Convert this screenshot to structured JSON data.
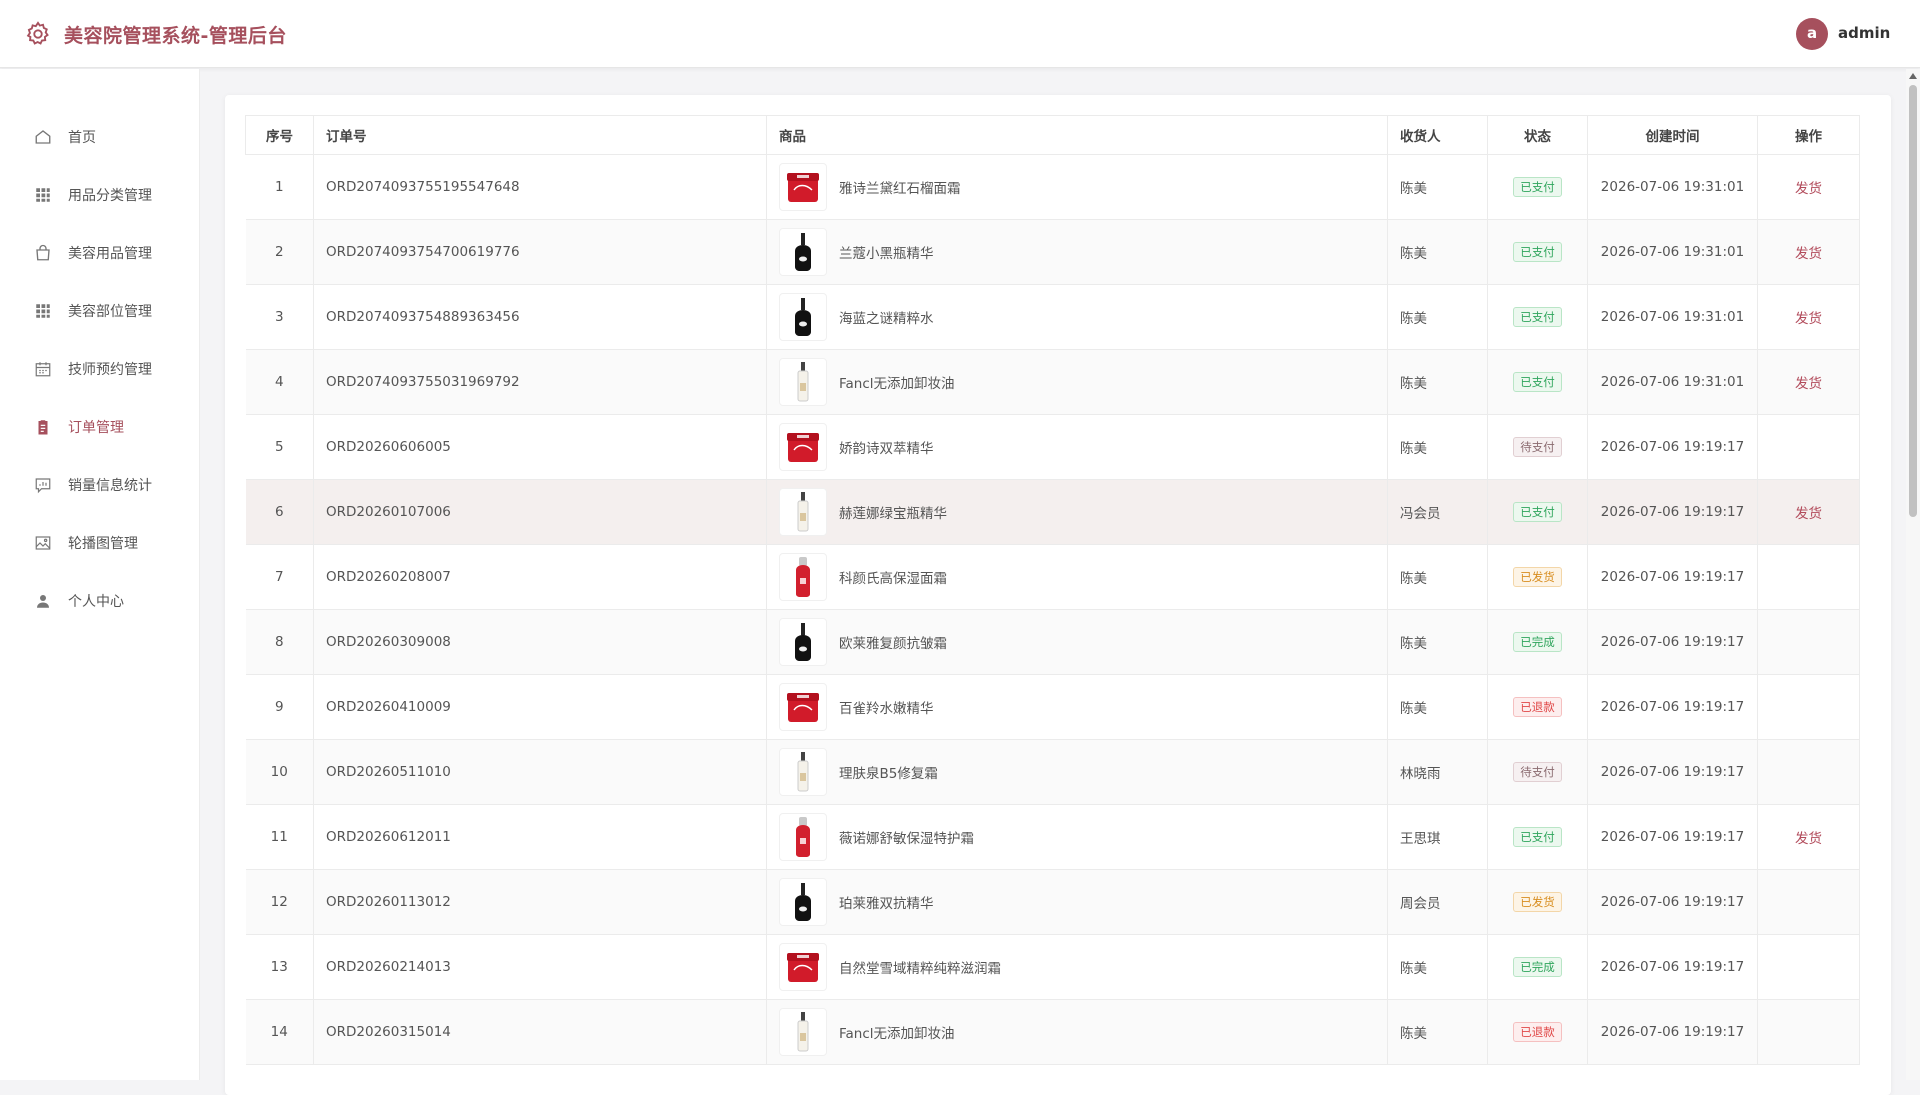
{
  "header": {
    "title": "美容院管理系统-管理后台",
    "avatar_letter": "a",
    "username": "admin",
    "brand_color": "#a6505d"
  },
  "sidebar": {
    "items": [
      {
        "label": "首页",
        "icon": "home-icon"
      },
      {
        "label": "用品分类管理",
        "icon": "grid-icon"
      },
      {
        "label": "美容用品管理",
        "icon": "bag-icon"
      },
      {
        "label": "美容部位管理",
        "icon": "grid-icon"
      },
      {
        "label": "技师预约管理",
        "icon": "calendar-icon"
      },
      {
        "label": "订单管理",
        "icon": "clipboard-icon",
        "active": true
      },
      {
        "label": "销量信息统计",
        "icon": "chat-chart-icon"
      },
      {
        "label": "轮播图管理",
        "icon": "image-icon"
      },
      {
        "label": "个人中心",
        "icon": "user-icon"
      }
    ]
  },
  "table": {
    "columns": [
      "序号",
      "订单号",
      "商品",
      "收货人",
      "状态",
      "创建时间",
      "操作"
    ],
    "rows": [
      {
        "no": "1",
        "order": "ORD2074093755195547648",
        "product": "雅诗兰黛红石榴面霜",
        "thumb": "jar",
        "receiver": "陈美",
        "status": "已支付",
        "status_type": "paid",
        "time": "2026-07-06 19:31:01",
        "action": "发货"
      },
      {
        "no": "2",
        "order": "ORD2074093754700619776",
        "product": "兰蔻小黑瓶精华",
        "thumb": "dropper",
        "receiver": "陈美",
        "status": "已支付",
        "status_type": "paid",
        "time": "2026-07-06 19:31:01",
        "action": "发货"
      },
      {
        "no": "3",
        "order": "ORD2074093754889363456",
        "product": "海蓝之谜精粹水",
        "thumb": "dropper",
        "receiver": "陈美",
        "status": "已支付",
        "status_type": "paid",
        "time": "2026-07-06 19:31:01",
        "action": "发货"
      },
      {
        "no": "4",
        "order": "ORD2074093755031969792",
        "product": "Fancl无添加卸妆油",
        "thumb": "bottle",
        "receiver": "陈美",
        "status": "已支付",
        "status_type": "paid",
        "time": "2026-07-06 19:31:01",
        "action": "发货"
      },
      {
        "no": "5",
        "order": "ORD20260606005",
        "product": "娇韵诗双萃精华",
        "thumb": "jar",
        "receiver": "陈美",
        "status": "待支付",
        "status_type": "pending",
        "time": "2026-07-06 19:19:17",
        "action": ""
      },
      {
        "no": "6",
        "order": "ORD20260107006",
        "product": "赫莲娜绿宝瓶精华",
        "thumb": "bottle",
        "receiver": "冯会员",
        "status": "已支付",
        "status_type": "paid",
        "time": "2026-07-06 19:19:17",
        "action": "发货",
        "hover": true
      },
      {
        "no": "7",
        "order": "ORD20260208007",
        "product": "科颜氏高保湿面霜",
        "thumb": "redbottle",
        "receiver": "陈美",
        "status": "已发货",
        "status_type": "shipped",
        "time": "2026-07-06 19:19:17",
        "action": ""
      },
      {
        "no": "8",
        "order": "ORD20260309008",
        "product": "欧莱雅复颜抗皱霜",
        "thumb": "dropper",
        "receiver": "陈美",
        "status": "已完成",
        "status_type": "done",
        "time": "2026-07-06 19:19:17",
        "action": ""
      },
      {
        "no": "9",
        "order": "ORD20260410009",
        "product": "百雀羚水嫩精华",
        "thumb": "jar",
        "receiver": "陈美",
        "status": "已退款",
        "status_type": "refund",
        "time": "2026-07-06 19:19:17",
        "action": ""
      },
      {
        "no": "10",
        "order": "ORD20260511010",
        "product": "理肤泉B5修复霜",
        "thumb": "bottle",
        "receiver": "林晓雨",
        "status": "待支付",
        "status_type": "pending",
        "time": "2026-07-06 19:19:17",
        "action": ""
      },
      {
        "no": "11",
        "order": "ORD20260612011",
        "product": "薇诺娜舒敏保湿特护霜",
        "thumb": "redbottle",
        "receiver": "王思琪",
        "status": "已支付",
        "status_type": "paid",
        "time": "2026-07-06 19:19:17",
        "action": "发货"
      },
      {
        "no": "12",
        "order": "ORD20260113012",
        "product": "珀莱雅双抗精华",
        "thumb": "dropper",
        "receiver": "周会员",
        "status": "已发货",
        "status_type": "shipped",
        "time": "2026-07-06 19:19:17",
        "action": ""
      },
      {
        "no": "13",
        "order": "ORD20260214013",
        "product": "自然堂雪域精粹纯粹滋润霜",
        "thumb": "jar",
        "receiver": "陈美",
        "status": "已完成",
        "status_type": "done",
        "time": "2026-07-06 19:19:17",
        "action": ""
      },
      {
        "no": "14",
        "order": "ORD20260315014",
        "product": "Fancl无添加卸妆油",
        "thumb": "bottle",
        "receiver": "陈美",
        "status": "已退款",
        "status_type": "refund",
        "time": "2026-07-06 19:19:17",
        "action": ""
      }
    ]
  }
}
